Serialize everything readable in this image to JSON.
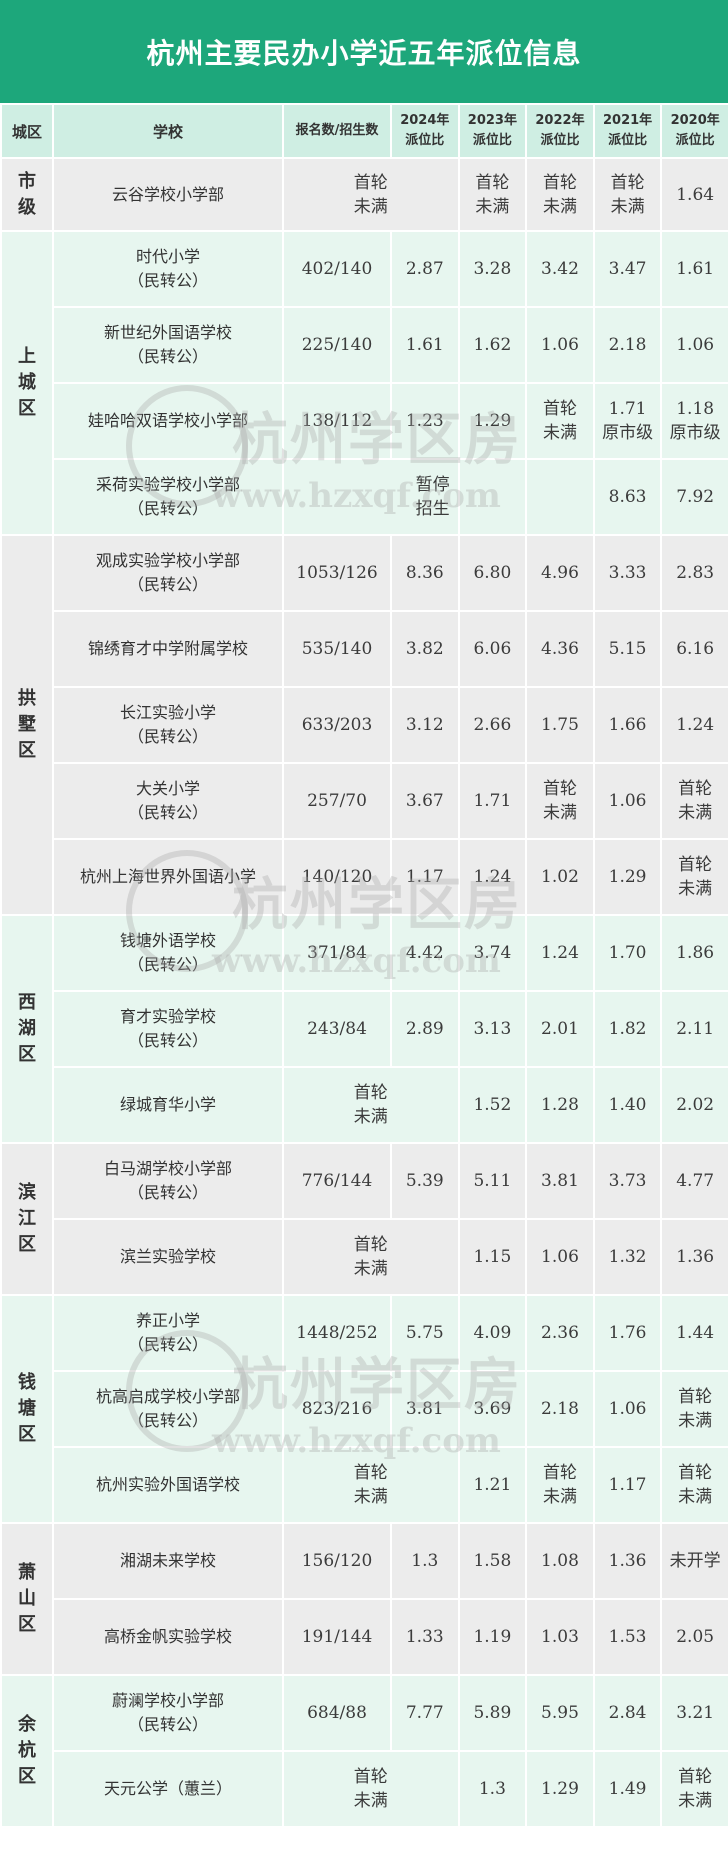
{
  "title": "杭州主要民办小学近五年派位信息",
  "headers": {
    "district": "城区",
    "school": "学校",
    "ratio": "报名数/招生数",
    "y2024": "2024年\n派位比",
    "y2023": "2023年\n派位比",
    "y2022": "2022年\n派位比",
    "y2021": "2021年\n派位比",
    "y2020": "2020年\n派位比"
  },
  "districts": {
    "shiji": "市级",
    "shangcheng": "上城区",
    "gongshu": "拱墅区",
    "xihu": "西湖区",
    "binjiang": "滨江区",
    "qiantang": "钱塘区",
    "xiaoshan": "萧山区",
    "yuhang": "余杭区"
  },
  "rows": [
    {
      "school": "云谷学校小学部",
      "ratio": "首轮\n未满",
      "y2023": "首轮\n未满",
      "y2022": "首轮\n未满",
      "y2021": "首轮\n未满",
      "y2020": "1.64"
    },
    {
      "school": "时代小学\n（民转公）",
      "ratio": "402/140",
      "y2024": "2.87",
      "y2023": "3.28",
      "y2022": "3.42",
      "y2021": "3.47",
      "y2020": "1.61"
    },
    {
      "school": "新世纪外国语学校\n（民转公）",
      "ratio": "225/140",
      "y2024": "1.61",
      "y2023": "1.62",
      "y2022": "1.06",
      "y2021": "2.18",
      "y2020": "1.06"
    },
    {
      "school": "娃哈哈双语学校小学部",
      "ratio": "138/112",
      "y2024": "1.23",
      "y2023": "1.29",
      "y2022": "首轮\n未满",
      "y2021": "1.71\n原市级",
      "y2020": "1.18\n原市级"
    },
    {
      "school": "采荷实验学校小学部\n（民转公）",
      "ratio": "暂停\n招生",
      "y2021": "8.63",
      "y2020": "7.92"
    },
    {
      "school": "观成实验学校小学部\n（民转公）",
      "ratio": "1053/126",
      "y2024": "8.36",
      "y2023": "6.80",
      "y2022": "4.96",
      "y2021": "3.33",
      "y2020": "2.83"
    },
    {
      "school": "锦绣育才中学附属学校",
      "ratio": "535/140",
      "y2024": "3.82",
      "y2023": "6.06",
      "y2022": "4.36",
      "y2021": "5.15",
      "y2020": "6.16"
    },
    {
      "school": "长江实验小学\n（民转公）",
      "ratio": "633/203",
      "y2024": "3.12",
      "y2023": "2.66",
      "y2022": "1.75",
      "y2021": "1.66",
      "y2020": "1.24"
    },
    {
      "school": "大关小学\n（民转公）",
      "ratio": "257/70",
      "y2024": "3.67",
      "y2023": "1.71",
      "y2022": "首轮\n未满",
      "y2021": "1.06",
      "y2020": "首轮\n未满"
    },
    {
      "school": "杭州上海世界外国语小学",
      "ratio": "140/120",
      "y2024": "1.17",
      "y2023": "1.24",
      "y2022": "1.02",
      "y2021": "1.29",
      "y2020": "首轮\n未满"
    },
    {
      "school": "钱塘外语学校\n（民转公）",
      "ratio": "371/84",
      "y2024": "4.42",
      "y2023": "3.74",
      "y2022": "1.24",
      "y2021": "1.70",
      "y2020": "1.86"
    },
    {
      "school": "育才实验学校\n（民转公）",
      "ratio": "243/84",
      "y2024": "2.89",
      "y2023": "3.13",
      "y2022": "2.01",
      "y2021": "1.82",
      "y2020": "2.11"
    },
    {
      "school": "绿城育华小学",
      "ratio": "首轮\n未满",
      "y2023": "1.52",
      "y2022": "1.28",
      "y2021": "1.40",
      "y2020": "2.02"
    },
    {
      "school": "白马湖学校小学部\n（民转公）",
      "ratio": "776/144",
      "y2024": "5.39",
      "y2023": "5.11",
      "y2022": "3.81",
      "y2021": "3.73",
      "y2020": "4.77"
    },
    {
      "school": "滨兰实验学校",
      "ratio": "首轮\n未满",
      "y2023": "1.15",
      "y2022": "1.06",
      "y2021": "1.32",
      "y2020": "1.36"
    },
    {
      "school": "养正小学\n（民转公）",
      "ratio": "1448/252",
      "y2024": "5.75",
      "y2023": "4.09",
      "y2022": "2.36",
      "y2021": "1.76",
      "y2020": "1.44"
    },
    {
      "school": "杭高启成学校小学部\n（民转公）",
      "ratio": "823/216",
      "y2024": "3.81",
      "y2023": "3.69",
      "y2022": "2.18",
      "y2021": "1.06",
      "y2020": "首轮\n未满"
    },
    {
      "school": "杭州实验外国语学校",
      "ratio": "首轮\n未满",
      "y2023": "1.21",
      "y2022": "首轮\n未满",
      "y2021": "1.17",
      "y2020": "首轮\n未满"
    },
    {
      "school": "湘湖未来学校",
      "ratio": "156/120",
      "y2024": "1.3",
      "y2023": "1.58",
      "y2022": "1.08",
      "y2021": "1.36",
      "y2020": "未开学"
    },
    {
      "school": "高桥金帆实验学校",
      "ratio": "191/144",
      "y2024": "1.33",
      "y2023": "1.19",
      "y2022": "1.03",
      "y2021": "1.53",
      "y2020": "2.05"
    },
    {
      "school": "蔚澜学校小学部\n（民转公）",
      "ratio": "684/88",
      "y2024": "7.77",
      "y2023": "5.89",
      "y2022": "5.95",
      "y2021": "2.84",
      "y2020": "3.21"
    },
    {
      "school": "天元公学（蕙兰）",
      "ratio": "首轮\n未满",
      "y2023": "1.3",
      "y2022": "1.29",
      "y2021": "1.49",
      "y2020": "首轮\n未满"
    }
  ],
  "watermark": {
    "name": "杭州学区房",
    "url": "www.hzxqf.com"
  }
}
